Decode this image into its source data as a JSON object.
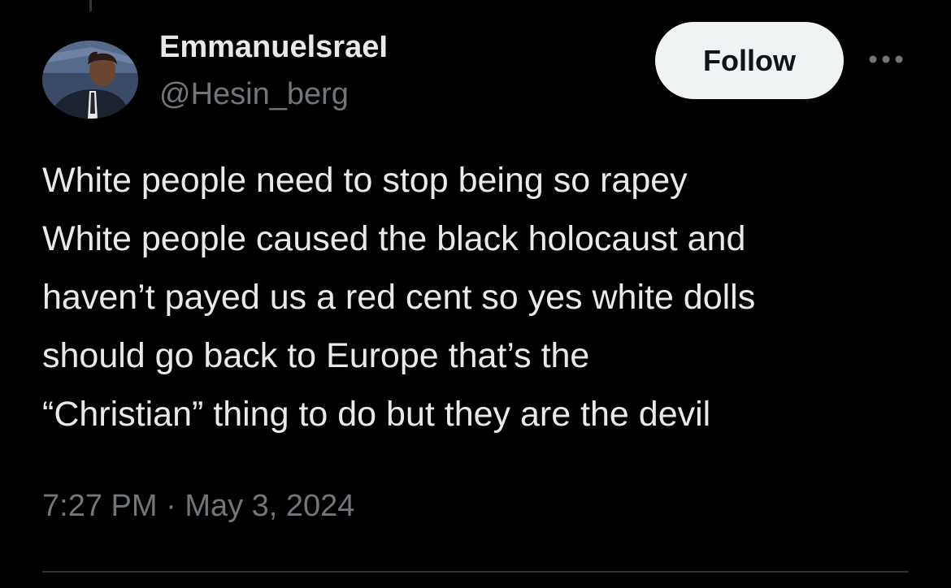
{
  "author": {
    "display_name": "EmmanuelsraeI",
    "handle": "@Hesin_berg",
    "avatar_icon": "profile-avatar"
  },
  "actions": {
    "follow_label": "Follow",
    "more_icon": "more-options-icon"
  },
  "tweet": {
    "lines": [
      "White people need to stop being so rapey",
      "White people caused the black holocaust and",
      "haven’t payed us a red cent so yes white dolls",
      "should go back to Europe that’s the",
      "“Christian” thing to do but they are the devil"
    ],
    "time": "7:27 PM",
    "separator": "·",
    "date": "May 3, 2024"
  },
  "colors": {
    "background": "#000000",
    "text_primary": "#e7e9ea",
    "text_secondary": "#71767b",
    "button_bg": "#eff3f4",
    "button_text": "#0f1419",
    "divider": "#2f3336"
  }
}
